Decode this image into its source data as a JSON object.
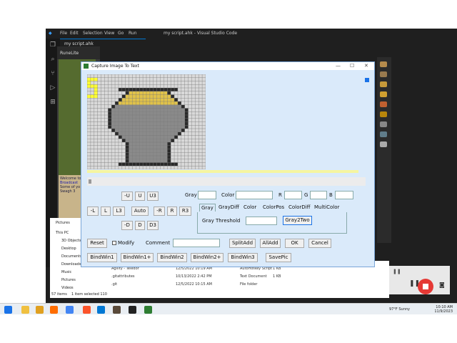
{
  "vscode": {
    "menu": [
      "File",
      "Edit",
      "Selection",
      "View",
      "Go",
      "Run"
    ],
    "title": "my script.ahk - Visual Studio Code",
    "tab_label": "my script.ahk",
    "activity_icons": [
      "files-icon",
      "search-icon",
      "source-control-icon",
      "run-debug-icon",
      "extensions-icon"
    ]
  },
  "runelite": {
    "title": "RuneLite",
    "chat_lines": [
      "Welcome to",
      "Broadcast",
      "Some of yo",
      "Swagh 3"
    ]
  },
  "explorer": {
    "items": [
      "Pictures",
      "This PC",
      "3D Objects",
      "Desktop",
      "Documents",
      "Downloads",
      "Music",
      "Pictures",
      "Videos"
    ],
    "status": [
      "57 items",
      "1 item selected 110 KB"
    ]
  },
  "files": [
    {
      "name": "Agility - Teledor",
      "date": "12/5/2022 10:19 AM",
      "type": "AutoHotkey Script",
      "size": "1 KB"
    },
    {
      "name": ".gitattributes",
      "date": "10/13/2022 2:42 PM",
      "type": "Text Document",
      "size": "1 KB"
    },
    {
      "name": ".git",
      "date": "12/5/2022 10:15 AM",
      "type": "File folder",
      "size": ""
    }
  ],
  "taskbar": {
    "weather": "97°F Sunny",
    "time": "10:10 AM",
    "date": "11/9/2023"
  },
  "dialog": {
    "title": "Capture Image To Text",
    "grid": {
      "cols": 34,
      "rows": 28
    },
    "row1": [
      "-U",
      "U",
      "U3"
    ],
    "row2": [
      "-L",
      "L",
      "L3",
      "Auto",
      "-R",
      "R",
      "R3"
    ],
    "row3": [
      "-D",
      "D",
      "D3"
    ],
    "labels": {
      "gray": "Gray",
      "color": "Color",
      "r": "R",
      "g": "G",
      "b": "B"
    },
    "tabs": [
      "Gray",
      "GrayDiff",
      "Color",
      "ColorPos",
      "ColorDiff",
      "MultiColor"
    ],
    "gray_threshold_label": "Gray Threshold",
    "gray2two": "Gray2Two",
    "reset": "Reset",
    "modify": "Modify",
    "comment": "Comment",
    "split_add": "SplitAdd",
    "all_add": "AllAdd",
    "ok": "OK",
    "cancel": "Cancel",
    "bind_buttons": [
      "BindWin1",
      "BindWin1+",
      "BindWin2",
      "BindWin2+",
      "BindWin3",
      "SavePic"
    ]
  },
  "colors": {
    "dialog_bg": "#daeafa",
    "accent": "#1a73e8",
    "record": "#e53935"
  }
}
